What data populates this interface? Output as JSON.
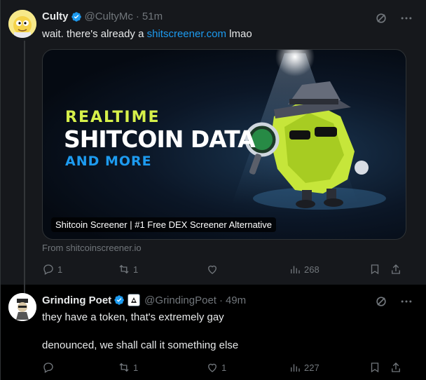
{
  "tweet1": {
    "name": "Culty",
    "handle": "@CultyMc",
    "dot": "·",
    "time": "51m",
    "text_before": "wait. there's already a ",
    "link": "shitscreener.com",
    "text_after": " lmao",
    "card": {
      "headline1": "REALTIME",
      "headline2": "SHITCOIN DATA",
      "headline3": "AND MORE",
      "caption": "Shitcoin Screener | #1 Free DEX Screener Alternative",
      "from": "From shitcoinscreener.io"
    },
    "actions": {
      "replies": "1",
      "reposts": "1",
      "likes": "",
      "views": "268"
    }
  },
  "tweet2": {
    "name": "Grinding Poet",
    "handle": "@GrindingPoet",
    "dot": "·",
    "time": "49m",
    "line1": "they have a token, that's extremely gay",
    "line2": "denounced, we shall call it something else",
    "actions": {
      "replies": "",
      "reposts": "1",
      "likes": "1",
      "views": "227"
    }
  },
  "colors": {
    "accent": "#1d9bf0",
    "muted": "#71767b",
    "text": "#e7e9ea",
    "neon": "#d6f04a"
  }
}
